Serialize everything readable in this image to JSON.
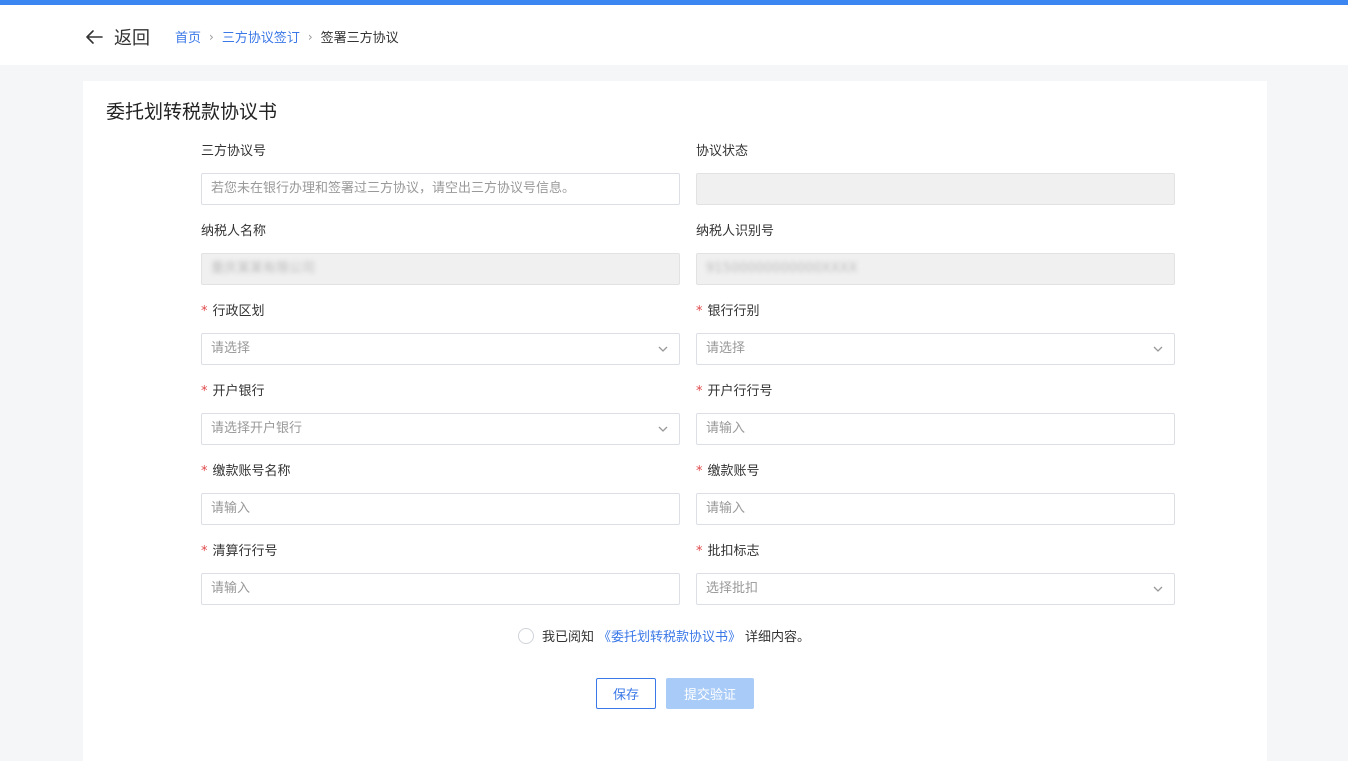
{
  "header": {
    "back_label": "返回",
    "breadcrumb": [
      "首页",
      "三方协议签订",
      "签署三方协议"
    ]
  },
  "page": {
    "title": "委托划转税款协议书"
  },
  "form": {
    "agreement_no": {
      "label": "三方协议号",
      "placeholder": "若您未在银行办理和签署过三方协议，请空出三方协议号信息。"
    },
    "agreement_status": {
      "label": "协议状态",
      "value": ""
    },
    "taxpayer_name": {
      "label": "纳税人名称",
      "value": "重庆某某有限公司"
    },
    "taxpayer_id": {
      "label": "纳税人识别号",
      "value": "91500000000000XXXX"
    },
    "admin_region": {
      "label": "行政区划",
      "placeholder": "请选择"
    },
    "bank_type": {
      "label": "银行行别",
      "placeholder": "请选择"
    },
    "open_bank": {
      "label": "开户银行",
      "placeholder": "请选择开户银行"
    },
    "open_bank_no": {
      "label": "开户行行号",
      "placeholder": "请输入"
    },
    "account_name": {
      "label": "缴款账号名称",
      "placeholder": "请输入"
    },
    "account_no": {
      "label": "缴款账号",
      "placeholder": "请输入"
    },
    "clearing_bank_no": {
      "label": "清算行行号",
      "placeholder": "请输入"
    },
    "batch_flag": {
      "label": "批扣标志",
      "placeholder": "选择批扣"
    },
    "required_mark": "*"
  },
  "agreement": {
    "prefix": "我已阅知",
    "link": "《委托划转税款协议书》",
    "suffix": "详细内容。"
  },
  "buttons": {
    "save": "保存",
    "submit": "提交验证"
  },
  "colors": {
    "accent": "#3b78e7",
    "top_bar": "#3b86f0",
    "required": "#e0474b",
    "submit_disabled": "#a9cbf7"
  }
}
